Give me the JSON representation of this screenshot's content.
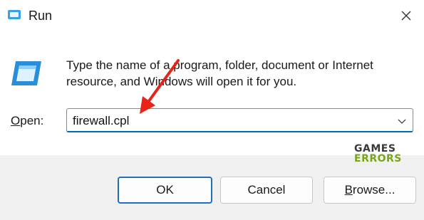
{
  "window": {
    "title": "Run",
    "close_icon": "close-icon",
    "app_icon": "run-dialog-icon"
  },
  "description": {
    "line1": "Type the name of a program, folder, document or Internet",
    "line2": "resource, and Windows will open it for you."
  },
  "open_field": {
    "label_prefix": "",
    "label_underlined": "O",
    "label_rest": "pen:",
    "value": "firewall.cpl",
    "dropdown_icon": "chevron-down-icon"
  },
  "buttons": {
    "ok": "OK",
    "cancel": "Cancel",
    "browse_underlined": "B",
    "browse_rest": "rowse..."
  },
  "watermark": {
    "line1": "GAMES",
    "line2": "ERRORS"
  },
  "annotation": {
    "arrow_color": "#e8231a"
  },
  "colors": {
    "accent": "#0067c0",
    "footer_bg": "#f0f0f0"
  }
}
